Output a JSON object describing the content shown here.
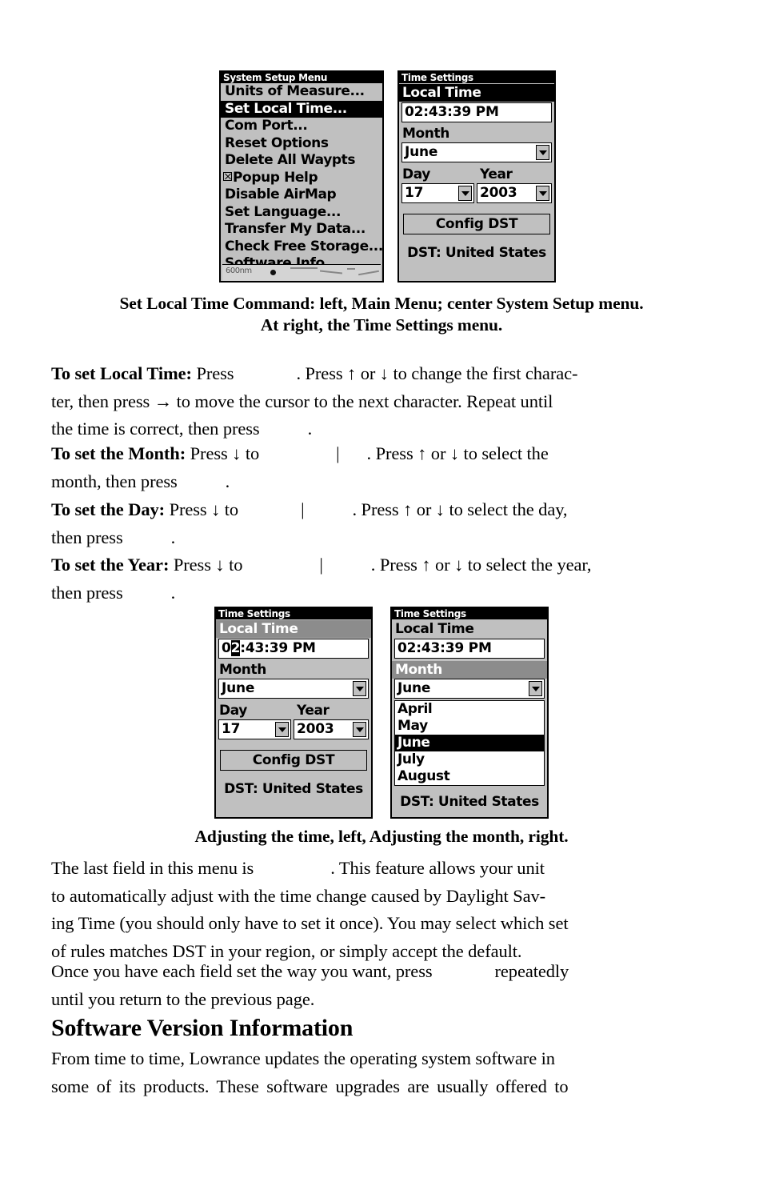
{
  "figure1": {
    "system_setup": {
      "title": "System Setup Menu",
      "items": [
        {
          "label": "Units of Measure...",
          "selected": false,
          "checkbox": false
        },
        {
          "label": "Set Local Time...",
          "selected": true,
          "checkbox": false
        },
        {
          "label": "Com Port...",
          "selected": false,
          "checkbox": false
        },
        {
          "label": "Reset Options",
          "selected": false,
          "checkbox": false
        },
        {
          "label": "Delete All Waypts",
          "selected": false,
          "checkbox": false
        },
        {
          "label": "Popup Help",
          "selected": false,
          "checkbox": true
        },
        {
          "label": "Disable AirMap",
          "selected": false,
          "checkbox": false
        },
        {
          "label": "Set Language...",
          "selected": false,
          "checkbox": false
        },
        {
          "label": "Transfer My Data...",
          "selected": false,
          "checkbox": false
        },
        {
          "label": "Check Free Storage...",
          "selected": false,
          "checkbox": false
        },
        {
          "label": "Software Info...",
          "selected": false,
          "checkbox": false
        }
      ],
      "map_scale": "600nm"
    },
    "time_settings": {
      "title": "Time Settings",
      "local_time_label": "Local Time",
      "local_time_value": "02:43:39  PM",
      "month_label": "Month",
      "month_value": "June",
      "day_label": "Day",
      "day_value": "17",
      "year_label": "Year",
      "year_value": "2003",
      "config_button": "Config DST",
      "dst_status": "DST: United States"
    }
  },
  "caption1": {
    "line1": "Set Local Time Command: left, Main Menu; center System Setup menu.",
    "line2": "At right, the Time Settings menu."
  },
  "body": {
    "p_local_time": {
      "lead": "To set Local Time:",
      "t1": " Press",
      "t2": ". Press ↑ or ↓ to change the first charac-",
      "t3": "ter, then press → to move the cursor to the next character. Repeat until",
      "t4": "the time is correct, then press",
      "t5": "."
    },
    "p_month": {
      "lead": "To set the Month:",
      "t1": " Press ↓ to",
      "bar": "|",
      "t2": ". Press ↑ or ↓ to select the",
      "t3": "month, then press",
      "t4": "."
    },
    "p_day": {
      "lead": "To set the Day:",
      "t1": " Press ↓ to",
      "bar": "|",
      "t2": ". Press ↑ or ↓ to select the day,",
      "t3": "then press",
      "t4": "."
    },
    "p_year": {
      "lead": "To set the Year:",
      "t1": " Press ↓ to",
      "bar": "|",
      "t2": ". Press ↑ or ↓ to select the year,",
      "t3": "then press",
      "t4": "."
    },
    "p_dst": {
      "t1": "The last field in this menu is",
      "t2": ". This feature allows your unit",
      "t3": "to automatically adjust with the time change caused by Daylight Sav-",
      "t4": "ing Time (you should only have to set it once). You may select which set",
      "t5": "of rules matches DST in your region, or simply accept the default."
    },
    "p_once": {
      "t1": "Once you have each field set the way you want, press",
      "t2": "repeatedly",
      "t3": "until you return to the previous page."
    },
    "p_final": {
      "t1": "From time to time, Lowrance updates the operating system software in",
      "t2": "some of its products. These software upgrades are usually offered to"
    }
  },
  "figure2": {
    "left": {
      "title": "Time Settings",
      "local_time_label": "Local Time",
      "time_before_cursor": "0",
      "time_cursor_char": "2",
      "time_after_cursor": ":43:39  PM",
      "month_label": "Month",
      "month_value": "June",
      "day_label": "Day",
      "day_value": "17",
      "year_label": "Year",
      "year_value": "2003",
      "config_button": "Config DST",
      "dst_status": "DST: United States"
    },
    "right": {
      "title": "Time Settings",
      "local_time_label": "Local Time",
      "local_time_value": "02:43:39  PM",
      "month_label": "Month",
      "month_value": "June",
      "month_options": [
        {
          "label": "April",
          "selected": false
        },
        {
          "label": "May",
          "selected": false
        },
        {
          "label": "June",
          "selected": true
        },
        {
          "label": "July",
          "selected": false
        },
        {
          "label": "August",
          "selected": false
        }
      ],
      "dst_status": "DST: United States"
    }
  },
  "caption2": {
    "line1": "Adjusting the time, left, Adjusting the month, right."
  },
  "section_heading": "Software Version Information"
}
